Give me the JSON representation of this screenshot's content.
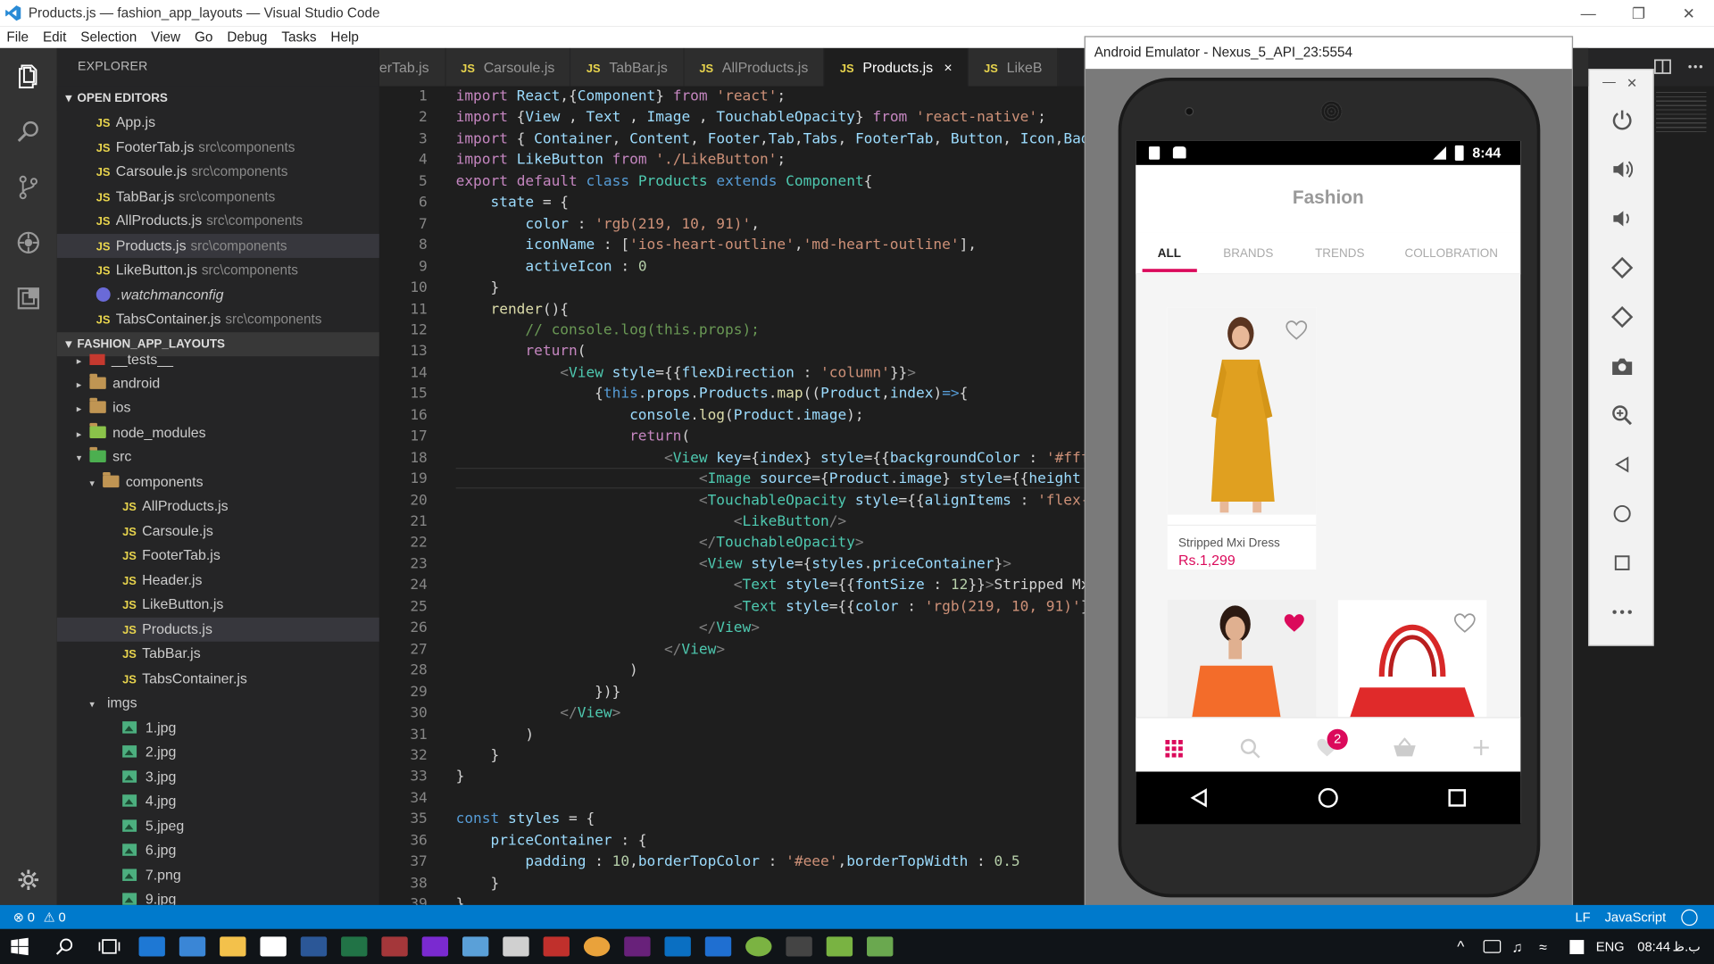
{
  "window": {
    "title": "Products.js — fashion_app_layouts — Visual Studio Code"
  },
  "menu": [
    "File",
    "Edit",
    "Selection",
    "View",
    "Go",
    "Debug",
    "Tasks",
    "Help"
  ],
  "explorer": {
    "header": "EXPLORER",
    "open_editors_label": "OPEN EDITORS",
    "open_editors": [
      {
        "name": "App.js",
        "path": ""
      },
      {
        "name": "FooterTab.js",
        "path": "src\\components"
      },
      {
        "name": "Carsoule.js",
        "path": "src\\components"
      },
      {
        "name": "TabBar.js",
        "path": "src\\components"
      },
      {
        "name": "AllProducts.js",
        "path": "src\\components"
      },
      {
        "name": "Products.js",
        "path": "src\\components"
      },
      {
        "name": "LikeButton.js",
        "path": "src\\components"
      },
      {
        "name": ".watchmanconfig",
        "path": ""
      },
      {
        "name": "TabsContainer.js",
        "path": "src\\components"
      }
    ],
    "project_label": "FASHION_APP_LAYOUTS",
    "tree": {
      "tests": "__tests__",
      "android": "android",
      "ios": "ios",
      "node_modules": "node_modules",
      "src": "src",
      "components": "components",
      "component_files": [
        "AllProducts.js",
        "Carsoule.js",
        "FooterTab.js",
        "Header.js",
        "LikeButton.js",
        "Products.js",
        "TabBar.js",
        "TabsContainer.js"
      ],
      "imgs": "imgs",
      "img_files": [
        "1.jpg",
        "2.jpg",
        "3.jpg",
        "4.jpg",
        "5.jpeg",
        "6.jpg",
        "7.png",
        "9.jpg"
      ]
    }
  },
  "tabs": [
    {
      "label": "erTab.js",
      "js": false
    },
    {
      "label": "Carsoule.js",
      "js": true
    },
    {
      "label": "TabBar.js",
      "js": true
    },
    {
      "label": "AllProducts.js",
      "js": true
    },
    {
      "label": "Products.js",
      "js": true,
      "active": true
    },
    {
      "label": "LikeB",
      "js": true
    }
  ],
  "tab_js_label": "JS",
  "close_glyph": "×",
  "status": {
    "errors": "0",
    "warnings": "0",
    "eol": "LF",
    "language": "JavaScript"
  },
  "emulator": {
    "title": "Android Emulator - Nexus_5_API_23:5554",
    "time": "8:44",
    "app_title": "Fashion",
    "tabs": [
      "ALL",
      "BRANDS",
      "TRENDS",
      "COLLOBRATION"
    ],
    "product_name": "Stripped Mxi Dress",
    "product_price": "Rs.1,299",
    "cart_badge": "2",
    "accent_color": "#db0a5b"
  },
  "taskbar": {
    "time": "08:44",
    "period": "ب.ظ",
    "lang": "ENG"
  },
  "glyphs": {
    "tri_down": "▾",
    "tri_right": "▸",
    "error": "⊗",
    "warning": "⚠"
  },
  "sidebar_js": "JS",
  "colors": {
    "status_bar": "#007acc",
    "activity_bar": "#333333",
    "sidebar": "#252526",
    "editor": "#1e1e1e"
  }
}
